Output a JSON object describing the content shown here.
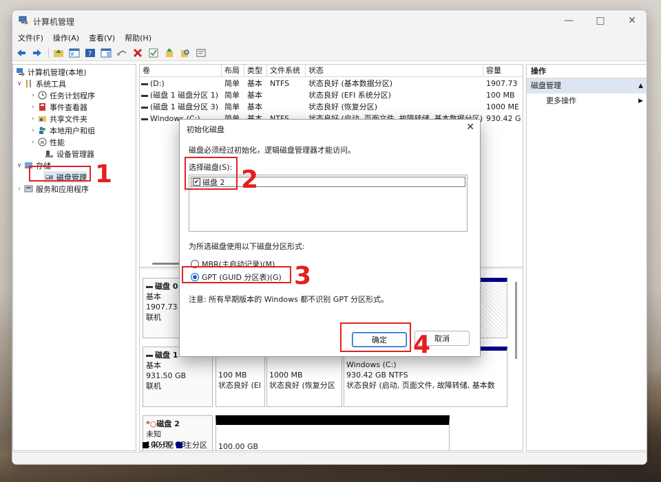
{
  "window": {
    "title": "计算机管理"
  },
  "menu": [
    "文件(F)",
    "操作(A)",
    "查看(V)",
    "帮助(H)"
  ],
  "toolbar_icons": [
    "back-arrow-icon",
    "forward-arrow-icon",
    "up-folder-icon",
    "console-tree-icon",
    "help-icon",
    "show-hide-pane-icon",
    "connect-icon",
    "delete-x-icon",
    "check-icon",
    "export-icon",
    "search-icon",
    "properties-icon"
  ],
  "tree": {
    "root": "计算机管理(本地)",
    "system_tools": "系统工具",
    "task_scheduler": "任务计划程序",
    "event_viewer": "事件查看器",
    "shared_folders": "共享文件夹",
    "local_users": "本地用户和组",
    "performance": "性能",
    "device_manager": "设备管理器",
    "storage": "存储",
    "disk_management": "磁盘管理",
    "services": "服务和应用程序"
  },
  "volume_table": {
    "headers": [
      "卷",
      "布局",
      "类型",
      "文件系统",
      "状态",
      "容量"
    ],
    "rows": [
      [
        "(D:)",
        "简单",
        "基本",
        "NTFS",
        "状态良好 (基本数据分区)",
        "1907.73"
      ],
      [
        "(磁盘 1 磁盘分区 1)",
        "简单",
        "基本",
        "",
        "状态良好 (EFI 系统分区)",
        "100 MB"
      ],
      [
        "(磁盘 1 磁盘分区 3)",
        "简单",
        "基本",
        "",
        "状态良好 (恢复分区)",
        "1000 ME"
      ],
      [
        "Windows (C:)",
        "简单",
        "基本",
        "NTFS",
        "状态良好 (启动, 页面文件, 故障转储, 基本数据分区)",
        "930.42 G"
      ]
    ]
  },
  "disks": {
    "disk0": {
      "name": "磁盘 0",
      "type": "基本",
      "size": "1907.73 G",
      "state": "联机"
    },
    "disk1": {
      "name": "磁盘 1",
      "type": "基本",
      "size": "931.50 GB",
      "state": "联机",
      "partitions": [
        {
          "size": "100 MB",
          "status": "状态良好 (EI"
        },
        {
          "size": "1000 MB",
          "status": "状态良好 (恢复分区"
        },
        {
          "label": "Windows (C:)",
          "size": "930.42 GB NTFS",
          "status": "状态良好 (启动, 页面文件, 故障转储, 基本数"
        }
      ]
    },
    "disk2": {
      "name": "磁盘 2",
      "type": "未知",
      "size": "100.00 GB",
      "state": "没有初始化",
      "unalloc": "100.00 GB"
    }
  },
  "legend": {
    "unallocated": "未分配",
    "primary": "主分区",
    "unallocated_color": "#000000",
    "primary_color": "#00008b"
  },
  "actions": {
    "header": "操作",
    "section": "磁盘管理",
    "more": "更多操作"
  },
  "dialog": {
    "title": "初始化磁盘",
    "intro": "磁盘必须经过初始化，逻辑磁盘管理器才能访问。",
    "select_label": "选择磁盘(S):",
    "disk_item": "磁盘 2",
    "style_label": "为所选磁盘使用以下磁盘分区形式:",
    "mbr": "MBR(主启动记录)(M)",
    "gpt": "GPT (GUID 分区表)(G)",
    "note": "注意: 所有早期版本的 Windows 都不识别 GPT 分区形式。",
    "ok": "确定",
    "cancel": "取消"
  },
  "callouts": [
    "1",
    "2",
    "3",
    "4"
  ],
  "colors": {
    "callout": "#e32020",
    "selection": "#dbe6f2",
    "accent": "#0a64c8"
  }
}
